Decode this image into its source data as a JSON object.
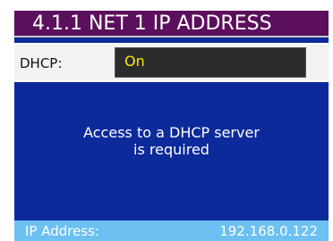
{
  "header": {
    "title": "4.1.1  NET 1 IP ADDRESS"
  },
  "dhcp": {
    "label": "DHCP:",
    "value": "On"
  },
  "message": {
    "line1": "Access to a DHCP server",
    "line2": "is required"
  },
  "status_bar": {
    "ip_label": "IP Address:",
    "ip_value": "192.168.0.122"
  },
  "colors": {
    "background": "#0d2a9b",
    "title_bar": "#5b0f5c",
    "value_text": "#ffe800",
    "status_bar": "#6cc0f2"
  }
}
